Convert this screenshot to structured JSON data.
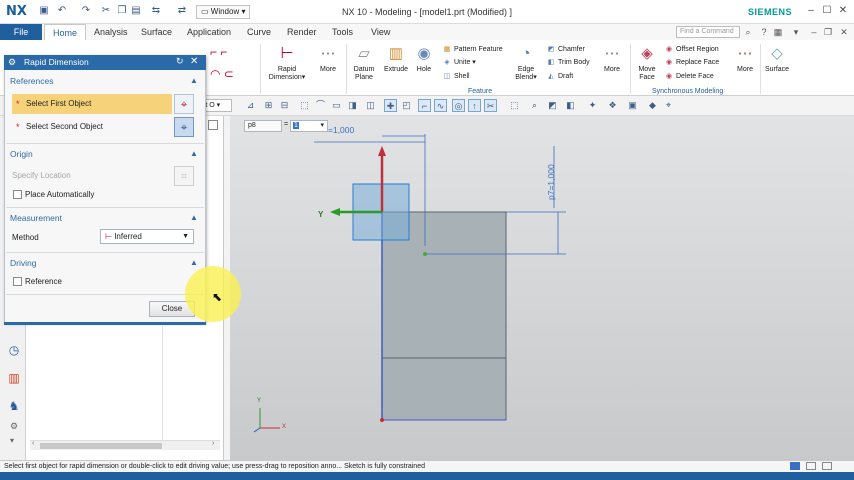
{
  "titlebar": {
    "logo": "NX",
    "window_menu": "Window",
    "title": "NX 10 - Modeling - [model1.prt (Modified) ]",
    "brand": "SIEMENS"
  },
  "menu": {
    "file": "File",
    "tabs": [
      "Home",
      "Analysis",
      "Surface",
      "Application",
      "Curve",
      "Render",
      "Tools",
      "View"
    ],
    "find_placeholder": "Find a Command"
  },
  "ribbon": {
    "rapid_dimension": "Rapid\nDimension",
    "more1": "More",
    "datum_plane": "Datum\nPlane",
    "extrude": "Extrude",
    "hole": "Hole",
    "pattern_feature": "Pattern Feature",
    "unite": "Unite",
    "shell": "Shell",
    "edge_blend": "Edge\nBlend",
    "chamfer": "Chamfer",
    "trim_body": "Trim Body",
    "draft": "Draft",
    "more2": "More",
    "move_face": "Move\nFace",
    "offset_region": "Offset Region",
    "replace_face": "Replace Face",
    "delete_face": "Delete Face",
    "more3": "More",
    "surface": "Surface",
    "group_feature": "Feature",
    "group_sync": "Synchronous Modeling"
  },
  "toolbar2": {
    "filter_text": "rt O"
  },
  "dimension_input": {
    "name": "p8",
    "equals": "=",
    "value": "1"
  },
  "canvas": {
    "dim_top": "=1,000",
    "dim_side": "p7=1,000",
    "axis_y": "Y",
    "triad_y": "Y",
    "triad_x": "X"
  },
  "dialog": {
    "title": "Rapid Dimension",
    "references": "References",
    "select_first": "Select First Object",
    "select_second": "Select Second Object",
    "origin": "Origin",
    "specify_location": "Specify Location",
    "place_auto": "Place Automatically",
    "measurement": "Measurement",
    "method_label": "Method",
    "method_value": "Inferred",
    "driving": "Driving",
    "reference": "Reference",
    "close": "Close"
  },
  "status": {
    "text": "Select first object for rapid dimension or double-click to edit driving value; use press-drag to reposition anno...   Sketch is fully constrained"
  },
  "colors": {
    "accent": "#1f5f9e",
    "selection": "#f6d27a",
    "sketch_line": "#3a6ec2",
    "body_fill": "#a8b2b8"
  }
}
